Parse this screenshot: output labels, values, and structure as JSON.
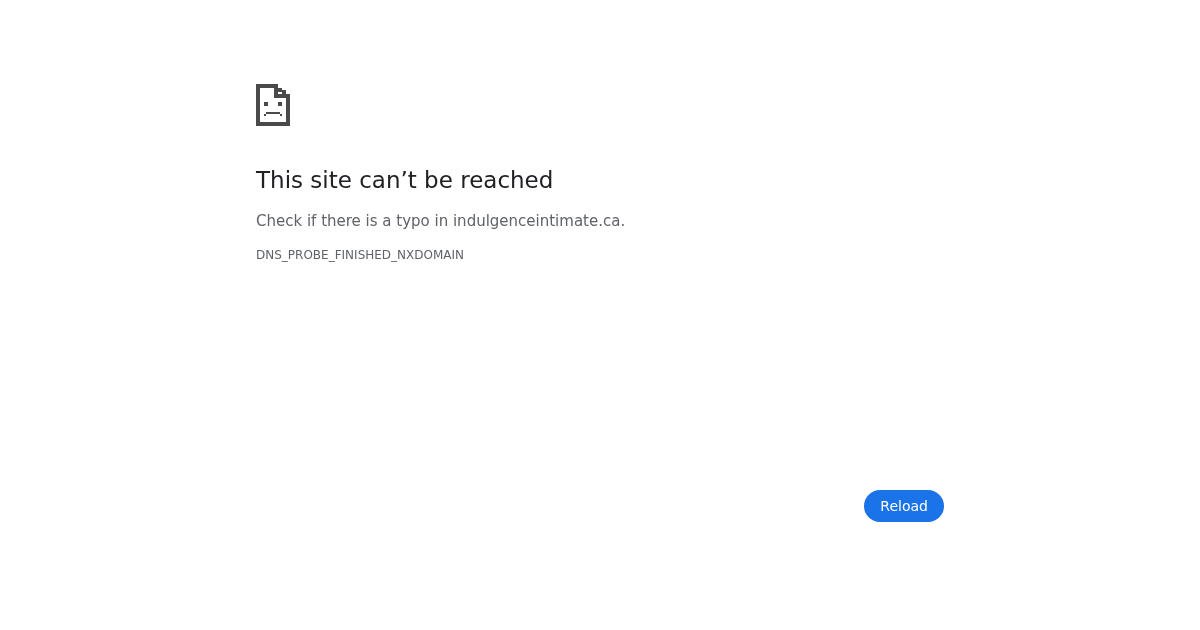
{
  "error": {
    "title": "This site can’t be reached",
    "message": "Check if there is a typo in indulgenceintimate.ca.",
    "code": "DNS_PROBE_FINISHED_NXDOMAIN"
  },
  "buttons": [
    {
      "label": "Reload"
    }
  ]
}
